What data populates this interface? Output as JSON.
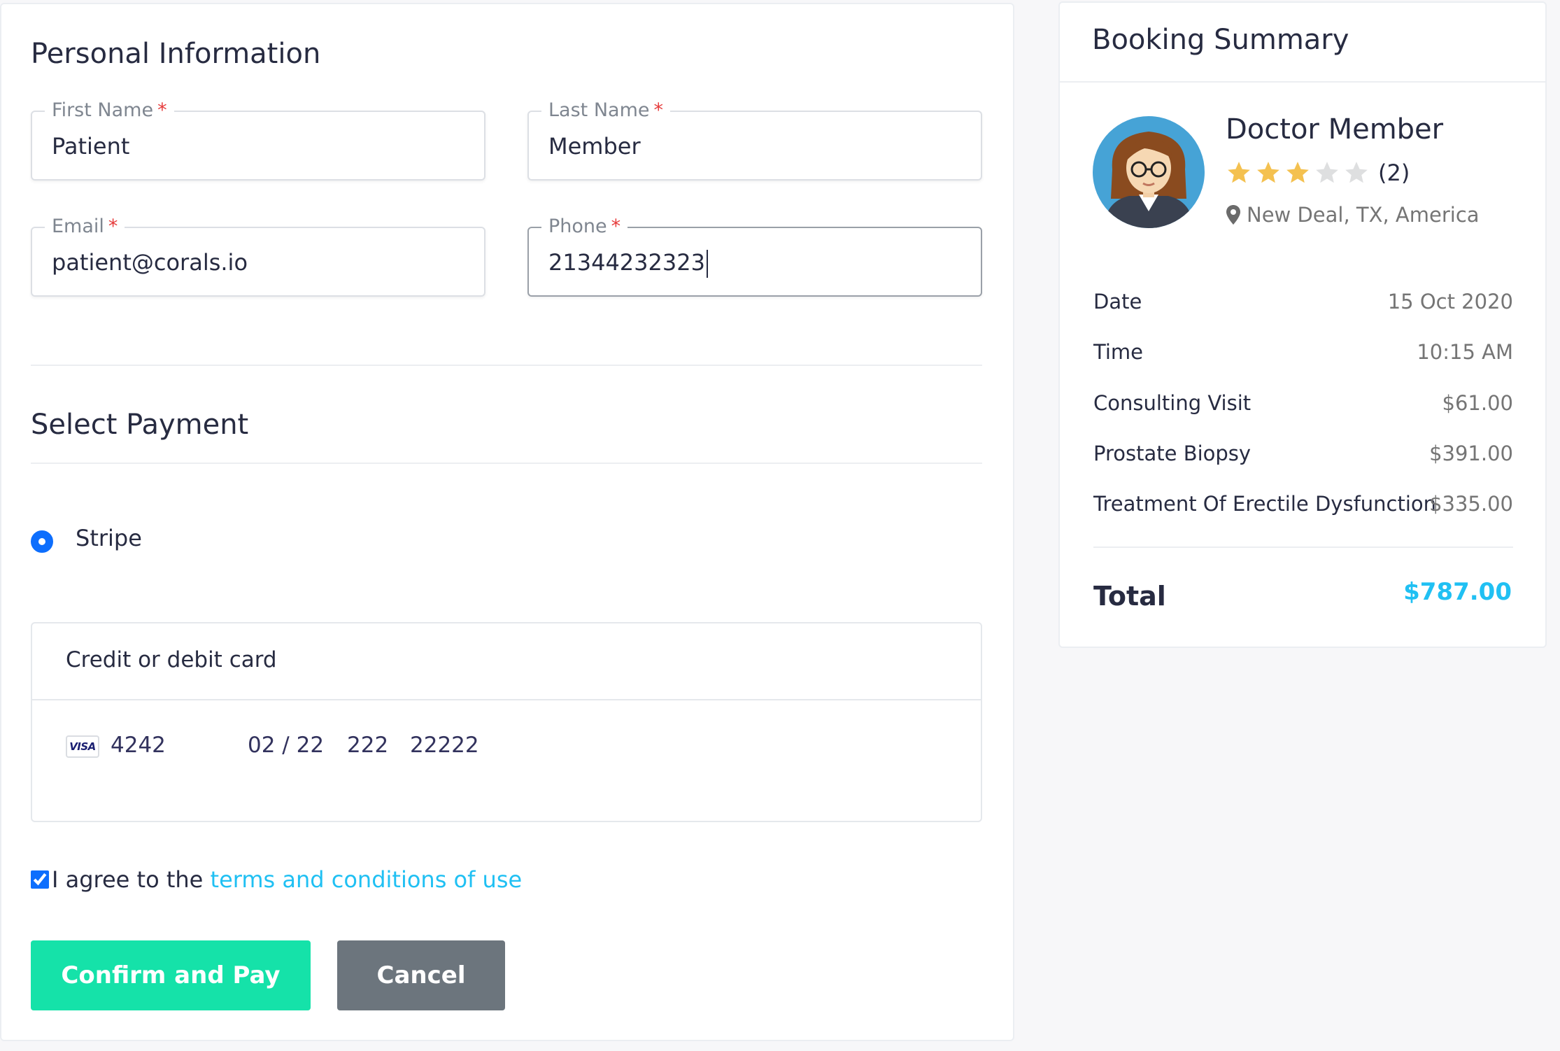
{
  "personal": {
    "title": "Personal Information",
    "first_name": {
      "label": "First Name",
      "required_mark": "*",
      "value": "Patient"
    },
    "last_name": {
      "label": "Last Name",
      "required_mark": "*",
      "value": "Member"
    },
    "email": {
      "label": "Email",
      "required_mark": "*",
      "value": "patient@corals.io"
    },
    "phone": {
      "label": "Phone",
      "required_mark": "*",
      "value": "21344232323"
    }
  },
  "payment": {
    "title": "Select Payment",
    "method_label": "Stripe",
    "card": {
      "header": "Credit or debit card",
      "brand": "VISA",
      "number_last4": "4242",
      "expiry": "02 / 22",
      "cvc": "222",
      "zip": "22222"
    },
    "agree_text": "I agree to the ",
    "agree_link": "terms and conditions of use",
    "confirm_label": "Confirm and Pay",
    "cancel_label": "Cancel"
  },
  "summary": {
    "title": "Booking Summary",
    "doctor_name": "Doctor Member",
    "rating": 3,
    "rating_max": 5,
    "rating_count": "(2)",
    "location": "New Deal, TX, America",
    "rows": [
      {
        "label": "Date",
        "value": "15 Oct 2020"
      },
      {
        "label": "Time",
        "value": "10:15 AM"
      },
      {
        "label": "Consulting Visit",
        "value": "$61.00"
      },
      {
        "label": "Prostate Biopsy",
        "value": "$391.00"
      },
      {
        "label": "Treatment Of Erectile Dysfunction",
        "value": "$335.00"
      }
    ],
    "total_label": "Total",
    "total_value": "$787.00"
  },
  "colors": {
    "accent": "#20c0f3",
    "confirm": "#15e2a9",
    "cancel": "#6c757d",
    "star_filled": "#f4c150",
    "star_empty": "#dedfe0",
    "required": "#e63c3c"
  }
}
